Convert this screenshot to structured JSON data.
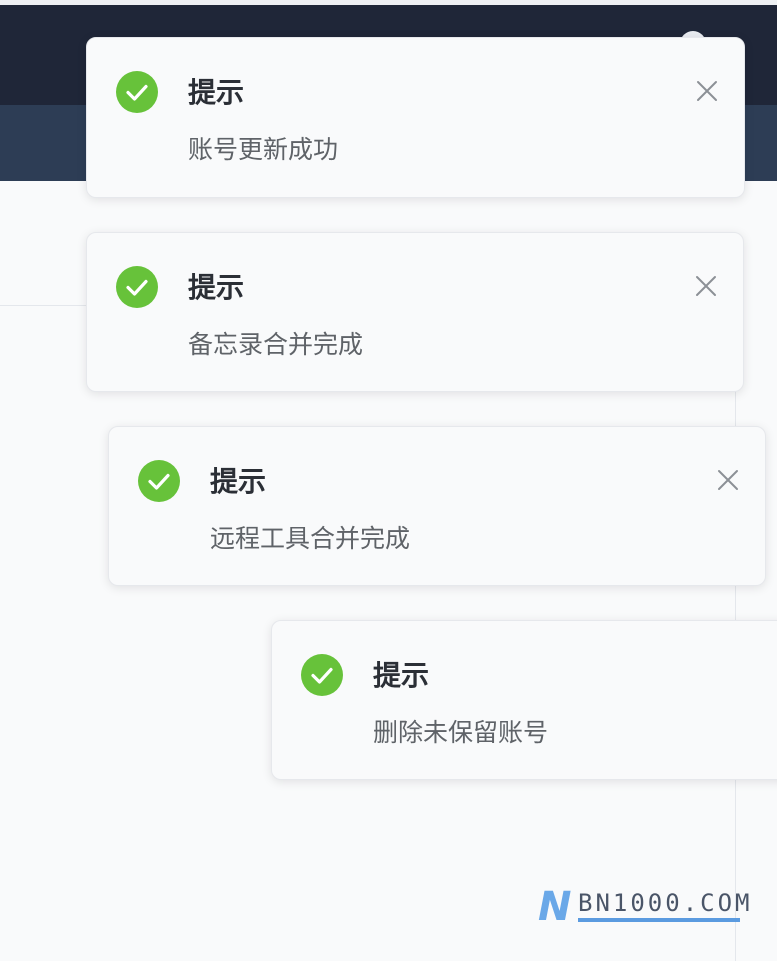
{
  "background": {
    "header_color": "#1f2638",
    "nav_color": "#2d3d55",
    "content_color": "#f9fafb"
  },
  "notifications": [
    {
      "title": "提示",
      "message": "账号更新成功",
      "type": "success",
      "icon": "success-check-icon",
      "closable": true
    },
    {
      "title": "提示",
      "message": "备忘录合并完成",
      "type": "success",
      "icon": "success-check-icon",
      "closable": true
    },
    {
      "title": "提示",
      "message": "远程工具合并完成",
      "type": "success",
      "icon": "success-check-icon",
      "closable": true
    },
    {
      "title": "提示",
      "message": "删除未保留账号",
      "type": "success",
      "icon": "success-check-icon",
      "closable": false
    }
  ],
  "colors": {
    "success": "#67c23a",
    "title": "#2b2f36",
    "message": "#5f6368"
  },
  "watermark": {
    "logo_letter": "N",
    "text": "BN1000.COM"
  }
}
